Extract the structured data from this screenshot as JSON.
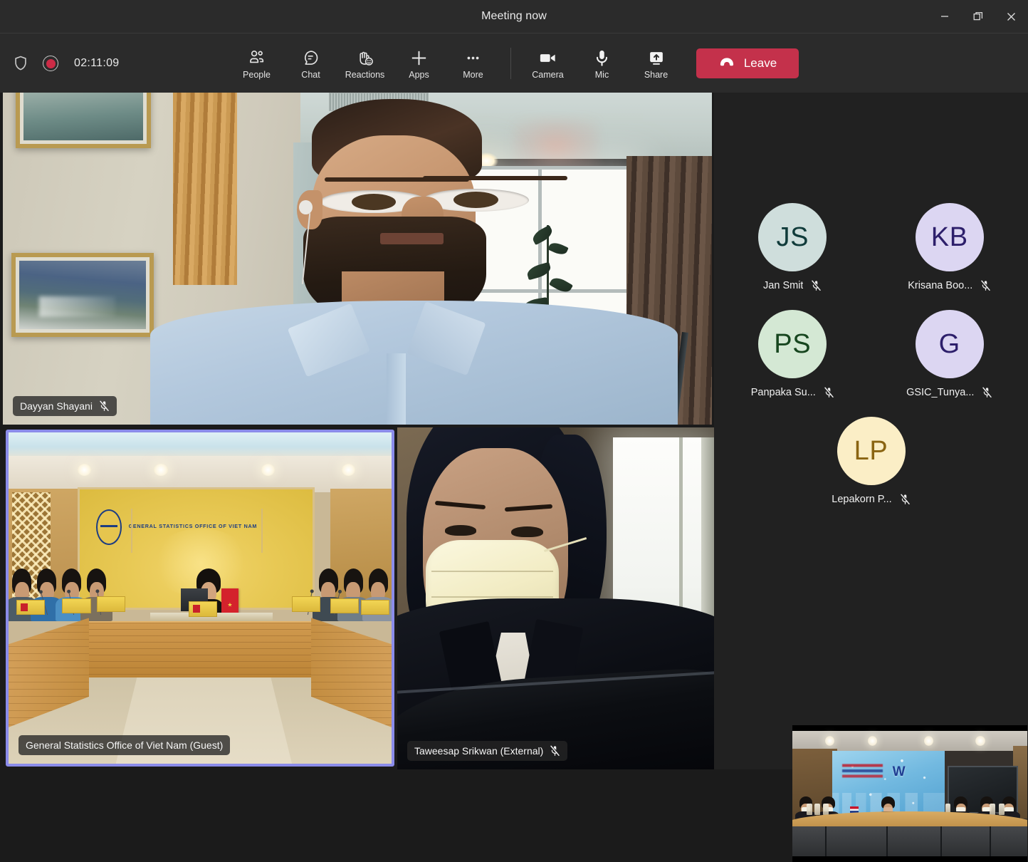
{
  "window": {
    "title": "Meeting now",
    "controls": [
      {
        "name": "minimize",
        "label": "Minimize"
      },
      {
        "name": "restore",
        "label": "Restore"
      },
      {
        "name": "close",
        "label": "Close"
      }
    ]
  },
  "action_bar": {
    "shield_icon": "shield-icon",
    "recording_icon": "recording-indicator-icon",
    "timer": "02:11:09",
    "items": [
      {
        "label": "People",
        "icon": "people-icon"
      },
      {
        "label": "Chat",
        "icon": "chat-icon"
      },
      {
        "label": "Reactions",
        "icon": "reactions-icon"
      },
      {
        "label": "Apps",
        "icon": "apps-plus-icon"
      },
      {
        "label": "More",
        "icon": "more-ellipsis-icon"
      }
    ],
    "devices": [
      {
        "label": "Camera",
        "icon": "camera-icon"
      },
      {
        "label": "Mic",
        "icon": "microphone-icon"
      },
      {
        "label": "Share",
        "icon": "share-screen-icon"
      }
    ],
    "leave": {
      "label": "Leave",
      "icon": "hangup-icon",
      "color": "#c4314b"
    }
  },
  "stage": {
    "tiles": [
      {
        "name": "Dayyan Shayani",
        "muted": true,
        "active_speaker": false,
        "scene": "man-with-beard-in-light-blue-shirt-indoor-room-with-framed-paintings-and-bright-window"
      },
      {
        "name": "General Statistics Office of Viet Nam (Guest)",
        "muted": false,
        "active_speaker": true,
        "active_border_color": "#8b8cea",
        "scene": "conference-room-with-yellow-banner-general-statistics-office-of-viet-nam",
        "banner_text": "GENERAL STATISTICS OFFICE OF VIET NAM"
      },
      {
        "name": "Taweesap Srikwan (External)",
        "muted": true,
        "active_speaker": false,
        "scene": "woman-in-dark-blazer-wearing-face-mask-looking-down-at-laptop"
      },
      {
        "name": "",
        "muted": false,
        "active_speaker": false,
        "scene": "thai-conference-room-with-blue-backdrop-screen-and-masked-participants"
      }
    ]
  },
  "sidebar": {
    "participants": [
      {
        "initials": "JS",
        "name": "Jan Smit",
        "muted": true,
        "bg": "#cfdedc",
        "fg": "#103b3a"
      },
      {
        "initials": "KB",
        "name": "Krisana Boo...",
        "muted": true,
        "bg": "#dcd6f2",
        "fg": "#2d1f6b"
      },
      {
        "initials": "PS",
        "name": "Panpaka Su...",
        "muted": true,
        "bg": "#d4e8d4",
        "fg": "#17461f"
      },
      {
        "initials": "G",
        "name": "GSIC_Tunya...",
        "muted": true,
        "bg": "#dcd6f2",
        "fg": "#2d1f6b"
      },
      {
        "initials": "LP",
        "name": "Lepakorn P...",
        "muted": true,
        "bg": "#fbeec6",
        "fg": "#8a6412"
      }
    ]
  }
}
